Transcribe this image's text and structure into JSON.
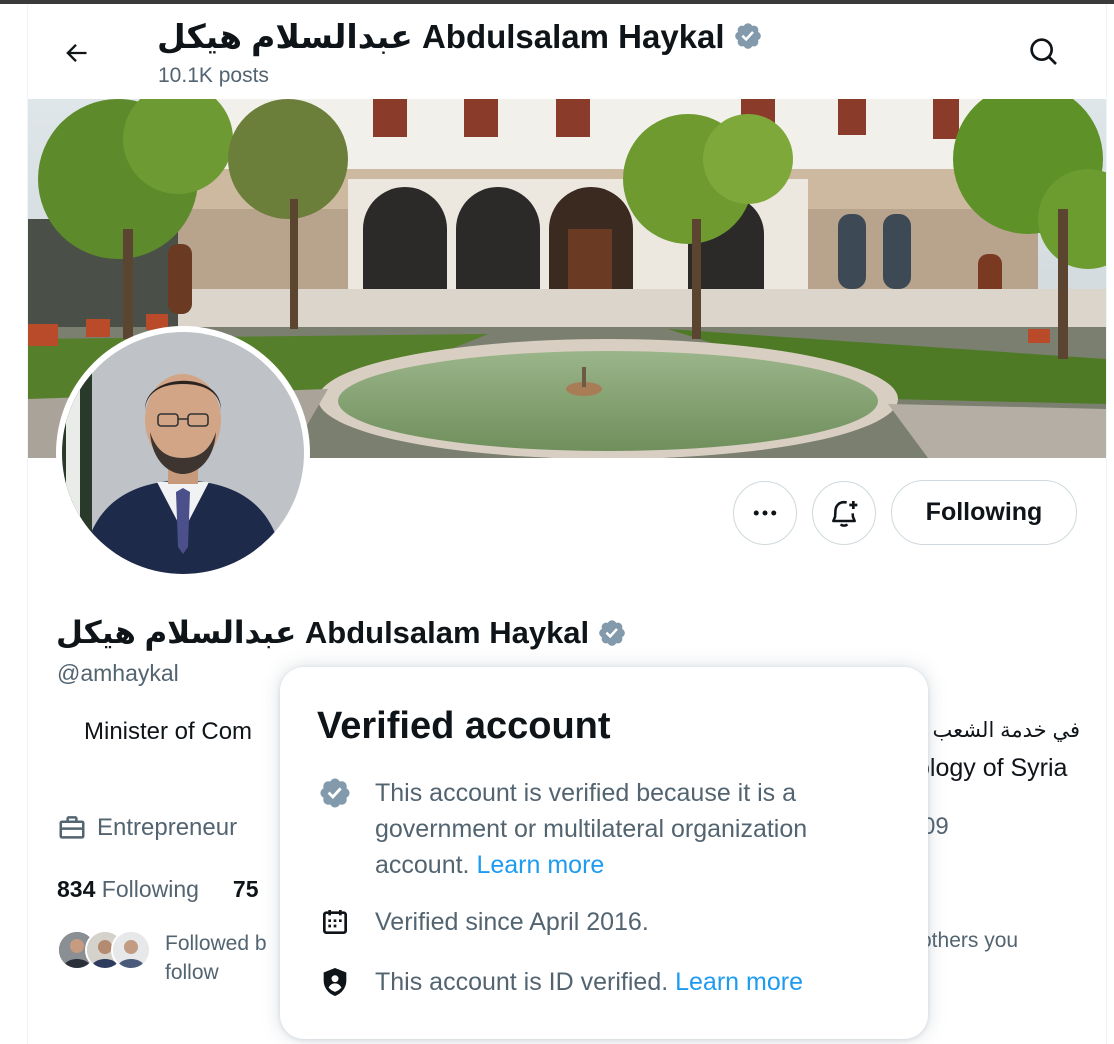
{
  "header": {
    "display_name": "عبدالسلام هيكل Abdulsalam Haykal",
    "posts_count": "10.1K posts"
  },
  "profile": {
    "display_name": "عبدالسلام هيكل Abdulsalam Haykal",
    "handle": "@amhaykal",
    "bio_line1_start": "Minister of Com",
    "bio_line1_arabic": "في خدمة الشعب السوري",
    "bio_line2_end": "ology of Syria",
    "job": "Entrepreneur",
    "joined_fragment": "09",
    "following_count": "834",
    "following_label": "Following",
    "followers_fragment": "75",
    "followed_by_start": "Followed b",
    "followed_by_end": "follow",
    "followed_by_others": "others you"
  },
  "actions": {
    "more_label": "•••",
    "following_button": "Following"
  },
  "verified_popover": {
    "title": "Verified account",
    "reason": "This account is verified because it is a government or multilateral organization account.",
    "reason_link": "Learn more",
    "since": "Verified since April 2016.",
    "id_verified": "This account is ID verified.",
    "id_link": "Learn more"
  },
  "colors": {
    "accent": "#1d9bf0",
    "badge_gray": "#829aab",
    "text_primary": "#0f1419",
    "text_secondary": "#536471"
  },
  "icons": [
    "back-arrow-icon",
    "search-icon",
    "verified-badge-icon",
    "more-icon",
    "notification-add-icon",
    "briefcase-icon",
    "calendar-icon",
    "shield-icon"
  ]
}
